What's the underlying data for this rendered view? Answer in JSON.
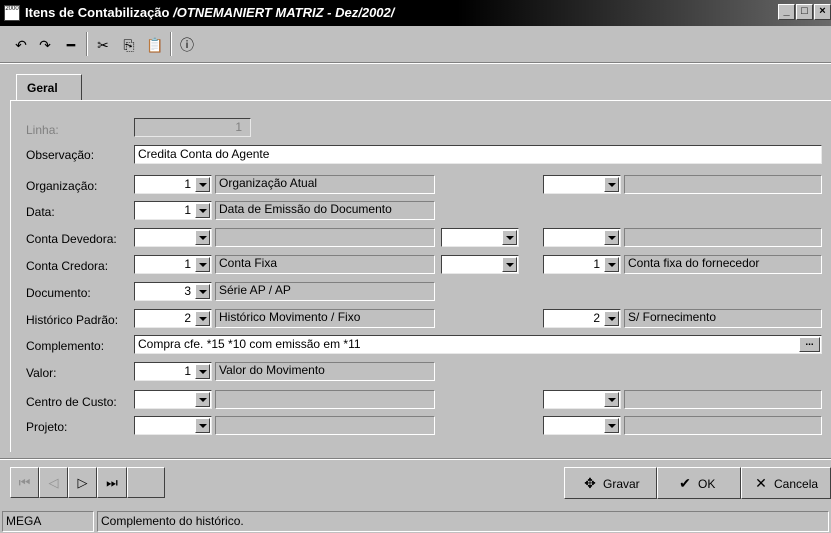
{
  "window": {
    "icon_text": "2000",
    "title_main": "Itens de Contabilização",
    "title_context": "/OTNEMANIERT MATRIZ - Dez/2002/",
    "minimize_icon": "minimize-icon",
    "maximize_icon": "maximize-icon",
    "close_icon": "close-icon"
  },
  "toolbar": {
    "undo": "↶",
    "redo": "↷",
    "remove": "━",
    "cut": "✂",
    "copy": "⎘",
    "paste": "📋",
    "info": "ⓘ"
  },
  "tabs": [
    {
      "label": "Geral"
    }
  ],
  "form": {
    "linha_label": "Linha:",
    "linha_value": "1",
    "observacao_label": "Observação:",
    "observacao_value": "Credita Conta do Agente",
    "organizacao_label": "Organização:",
    "organizacao_value": "1",
    "organizacao_desc": "Organização Atual",
    "organizacao_code2": "",
    "organizacao_desc2": "",
    "data_label": "Data:",
    "data_value": "1",
    "data_desc": "Data de Emissão do Documento",
    "conta_devedora_label": "Conta Devedora:",
    "conta_devedora_value": "",
    "conta_devedora_desc": "",
    "conta_devedora_code2": "",
    "conta_devedora_code3": "",
    "conta_devedora_desc3": "",
    "conta_credora_label": "Conta Credora:",
    "conta_credora_value": "1",
    "conta_credora_desc": "Conta Fixa",
    "conta_credora_code2": "",
    "conta_credora_code3": "1",
    "conta_credora_desc3": "Conta fixa do fornecedor",
    "documento_label": "Documento:",
    "documento_value": "3",
    "documento_desc": "Série AP / AP",
    "historico_label": "Histórico Padrão:",
    "historico_value": "2",
    "historico_desc": "Histórico Movimento / Fixo",
    "historico_code3": "2",
    "historico_desc3": "S/ Fornecimento",
    "complemento_label": "Complemento:",
    "complemento_value": "Compra cfe. *15 *10 com emissão em *11",
    "complemento_button": "...",
    "valor_label": "Valor:",
    "valor_value": "1",
    "valor_desc": "Valor do Movimento",
    "centro_label": "Centro de Custo:",
    "centro_value": "",
    "centro_desc": "",
    "centro_code3": "",
    "centro_desc3": "",
    "projeto_label": "Projeto:",
    "projeto_value": "",
    "projeto_desc": "",
    "projeto_code3": "",
    "projeto_desc3": ""
  },
  "nav": {
    "first": "⏮",
    "prev": "◁",
    "next": "▷",
    "last": "⏭"
  },
  "actions": {
    "gravar": "Gravar",
    "ok": "OK",
    "cancela": "Cancela"
  },
  "status": {
    "left": "MEGA",
    "message": "Complemento do histórico."
  }
}
